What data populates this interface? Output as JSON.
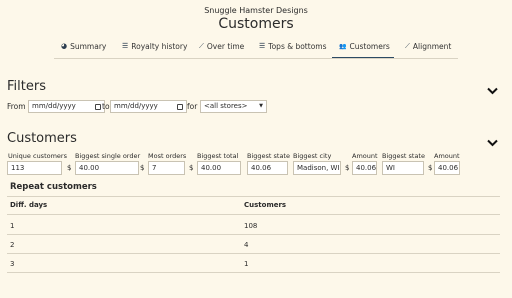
{
  "header": {
    "brand": "Snuggle Hamster Designs",
    "title": "Customers"
  },
  "tabs": [
    {
      "icon": "pie-chart-icon",
      "glyph": "◕",
      "label": "Summary"
    },
    {
      "icon": "list-icon",
      "glyph": "☰",
      "label": "Royalty history"
    },
    {
      "icon": "line-chart-icon",
      "glyph": "⟋",
      "label": "Over time"
    },
    {
      "icon": "list-icon",
      "glyph": "☰",
      "label": "Tops & bottoms"
    },
    {
      "icon": "users-icon",
      "glyph": "👥",
      "label": "Customers",
      "active": true
    },
    {
      "icon": "line-chart-icon",
      "glyph": "⟋",
      "label": "Alignment"
    }
  ],
  "filters": {
    "heading": "Filters",
    "from_label": "From",
    "from_placeholder": "mm/dd/yyyy",
    "to_label": "to",
    "to_placeholder": "mm/dd/yyyy",
    "for_label": "for",
    "store_selected": "<all stores>"
  },
  "customers": {
    "heading": "Customers",
    "stats": [
      {
        "label": "Unique customers",
        "value": "113"
      },
      {
        "label": "Biggest single order",
        "currency": "$",
        "value": "40.00"
      },
      {
        "label": "Most orders",
        "currency": "$",
        "value": "7"
      },
      {
        "label": "Biggest total",
        "currency": "$",
        "value": "40.00"
      },
      {
        "label": "Biggest state",
        "value": "40.06"
      },
      {
        "label": "Biggest city",
        "value": "Madison, WI"
      },
      {
        "label": "Amount",
        "currency": "$",
        "value": "40.06"
      },
      {
        "label": "Biggest state",
        "value": "WI"
      },
      {
        "label": "Amount",
        "currency": "$",
        "value": "40.06"
      }
    ]
  },
  "repeat": {
    "heading": "Repeat customers",
    "columns": [
      "Diff. days",
      "Customers"
    ],
    "rows": [
      [
        "1",
        "108"
      ],
      [
        "2",
        "4"
      ],
      [
        "3",
        "1"
      ]
    ]
  },
  "colors": {
    "background": "#fdf8ea",
    "active_tab": "#2c4a63",
    "border": "#c9c3b3"
  }
}
